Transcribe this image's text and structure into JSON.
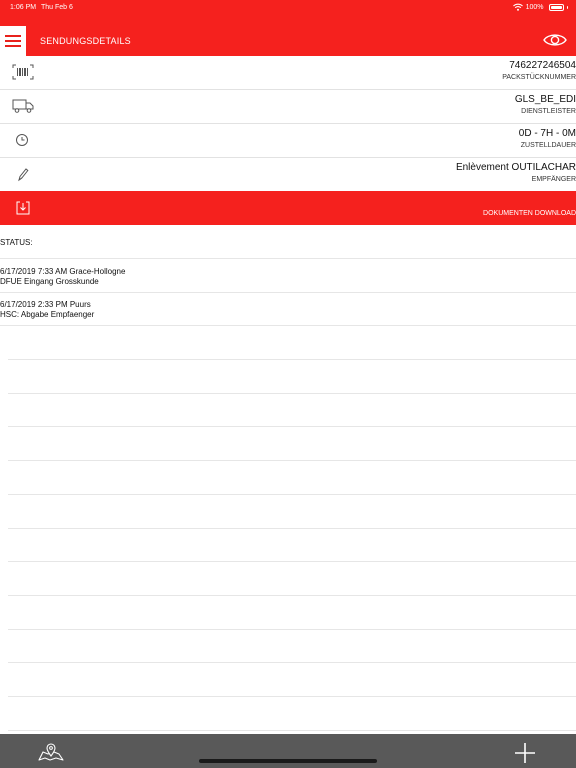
{
  "status_bar": {
    "time": "1:06 PM",
    "date": "Thu Feb 6",
    "battery": "100%"
  },
  "header": {
    "title": "SENDUNGSDETAILS"
  },
  "details": [
    {
      "icon": "barcode-icon",
      "value": "746227246504",
      "label": "PACKSTÜCKNUMMER"
    },
    {
      "icon": "truck-icon",
      "value": "GLS_BE_EDI",
      "label": "DIENSTLEISTER"
    },
    {
      "icon": "clock-icon",
      "value": "0D - 7H - 0M",
      "label": "ZUSTELLDAUER"
    },
    {
      "icon": "pencil-icon",
      "value": "Enlèvement OUTILACHAR",
      "label": "EMPFÄNGER"
    }
  ],
  "download": {
    "label": "DOKUMENTEN DOWNLOAD"
  },
  "status": {
    "heading": "STATUS:",
    "entries": [
      {
        "line1": "6/17/2019 7:33 AM Grace-Hollogne",
        "line2": "DFUE Eingang Grosskunde"
      },
      {
        "line1": "6/17/2019 2:33 PM Puurs",
        "line2": "HSC: Abgabe Empfaenger"
      }
    ]
  },
  "colors": {
    "brand_red": "#f5211e",
    "tab_bar": "#595959"
  }
}
